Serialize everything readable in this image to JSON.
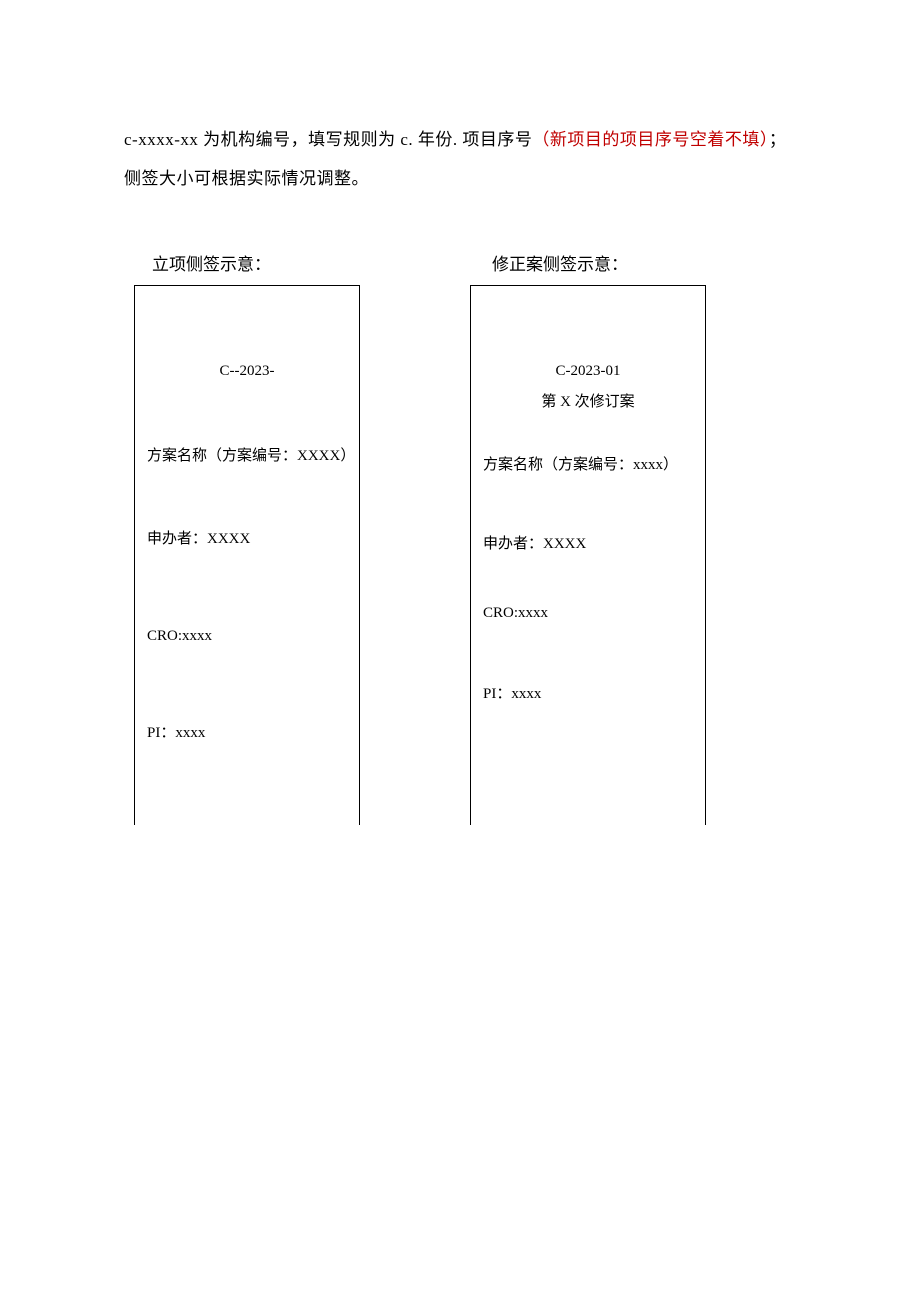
{
  "intro": {
    "part1": "c-xxxx-xx 为机构编号，填写规则为 c. 年份. 项目序号",
    "red": "（新项目的项目序号空着不填）",
    "part2": "；侧签大小可根据实际情况调整。"
  },
  "left": {
    "label": "立项侧签示意：",
    "code": "C--2023-",
    "scheme": "方案名称（方案编号：XXXX）",
    "sponsor": "申办者：XXXX",
    "cro": "CRO:xxxx",
    "pi": "PI：xxxx"
  },
  "right": {
    "label": "修正案侧签示意：",
    "code": "C-2023-01",
    "revision": "第 X 次修订案",
    "scheme": "方案名称（方案编号：xxxx）",
    "sponsor": "申办者：XXXX",
    "cro": "CRO:xxxx",
    "pi": "PI：xxxx"
  }
}
